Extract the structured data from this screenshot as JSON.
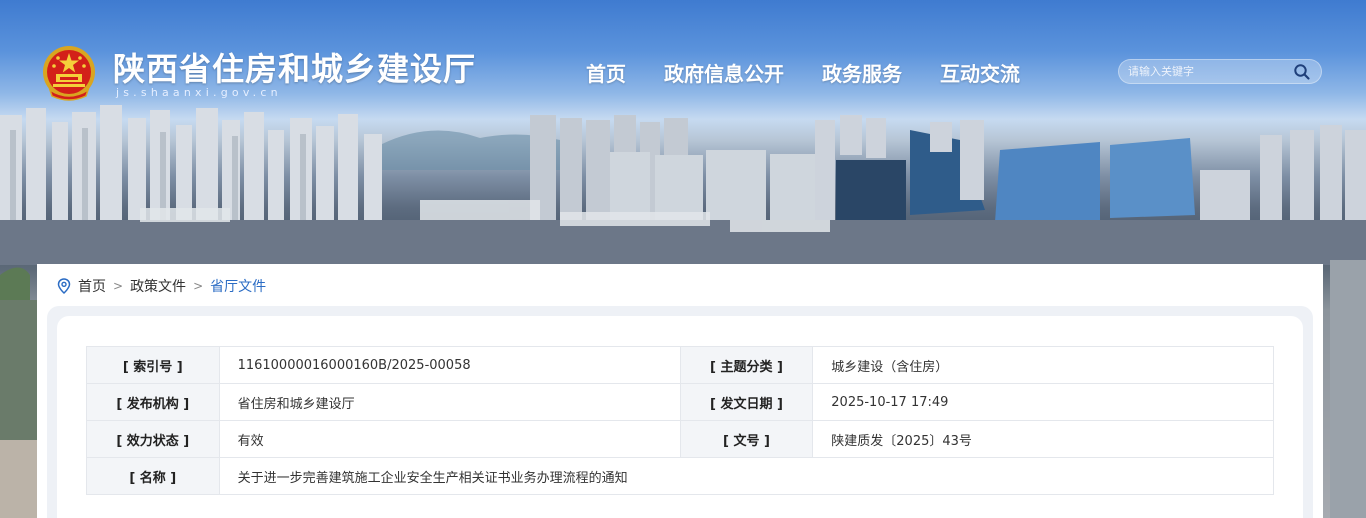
{
  "header": {
    "site_title": "陕西省住房和城乡建设厅",
    "site_domain": "js.shaanxi.gov.cn",
    "logo_icon": "national-emblem-icon",
    "nav": [
      "首页",
      "政府信息公开",
      "政务服务",
      "互动交流"
    ],
    "search": {
      "placeholder": "请输入关键字",
      "button_icon": "search-icon"
    }
  },
  "breadcrumb": {
    "icon": "location-pin-icon",
    "items": [
      "首页",
      "政策文件",
      "省厅文件"
    ],
    "separator": ">"
  },
  "document_info": {
    "index_no_label": "[ 索引号 ]",
    "index_no": "11610000016000160B/2025-00058",
    "topic_label": "[ 主题分类 ]",
    "topic": "城乡建设（含住房）",
    "issuer_label": "[ 发布机构 ]",
    "issuer": "省住房和城乡建设厅",
    "date_label": "[ 发文日期 ]",
    "date": "2025-10-17 17:49",
    "status_label": "[ 效力状态 ]",
    "status": "有效",
    "doc_no_label": "[ 文号 ]",
    "doc_no": "陕建质发〔2025〕43号",
    "name_label": "[ 名称 ]",
    "name": "关于进一步完善建筑施工企业安全生产相关证书业务办理流程的通知"
  },
  "colors": {
    "status_valid": "#2e9a3a",
    "breadcrumb_current": "#2b6cc4",
    "label_bg": "#f3f5f8"
  }
}
